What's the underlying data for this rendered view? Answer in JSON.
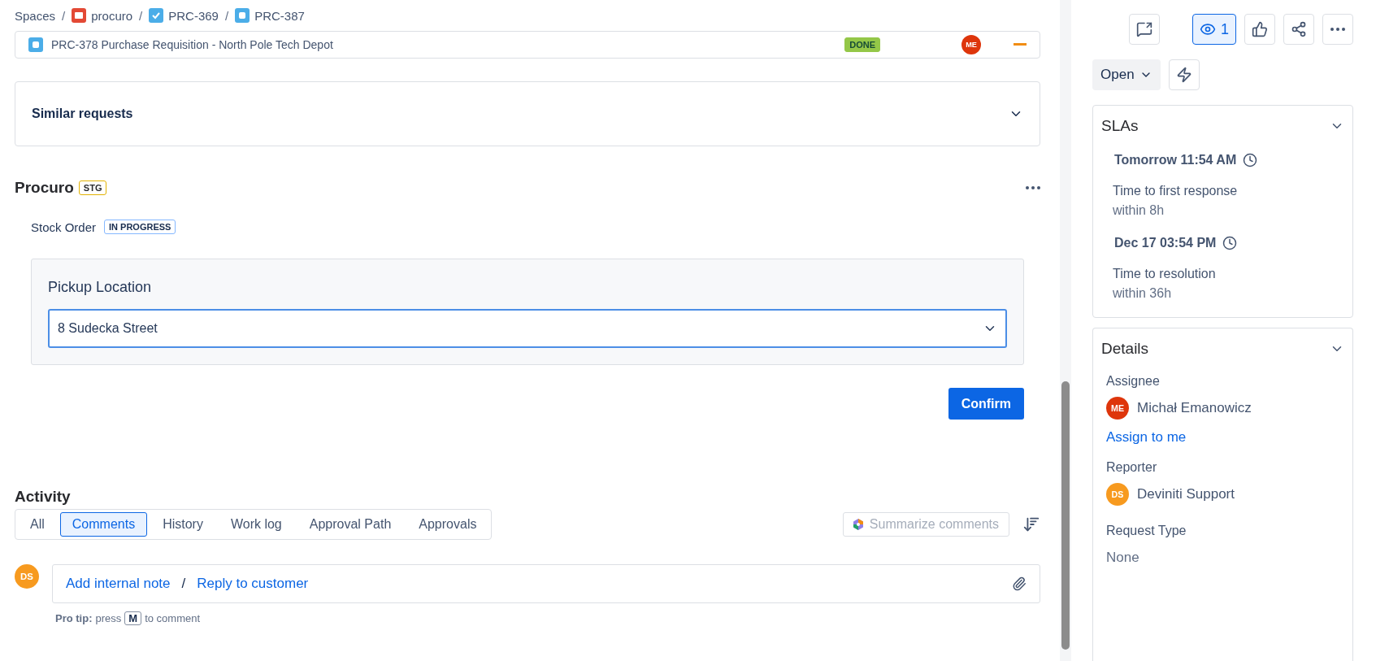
{
  "breadcrumbs": [
    {
      "label": "Spaces",
      "kind": "text",
      "sep": "/"
    },
    {
      "label": "procuro",
      "kind": "project",
      "sep": "/"
    },
    {
      "label": "PRC-369",
      "kind": "task",
      "sep": "/"
    },
    {
      "label": "PRC-387",
      "kind": "request"
    }
  ],
  "linked_item": {
    "title": "PRC-378 Purchase Requisition - North Pole Tech Depot",
    "status": "DONE",
    "assignee": "ME"
  },
  "similar_requests": {
    "title": "Similar requests"
  },
  "app_panel": {
    "title": "Procuro",
    "env": "STG",
    "item": "Stock Order",
    "status": "IN PROGRESS",
    "field_label": "Pickup Location",
    "field_value": "8 Sudecka Street",
    "confirm": "Confirm"
  },
  "activity": {
    "title": "Activity",
    "tabs": [
      {
        "label": "All",
        "selected": false
      },
      {
        "label": "Comments",
        "selected": true
      },
      {
        "label": "History",
        "selected": false
      },
      {
        "label": "Work log",
        "selected": false
      },
      {
        "label": "Approval Path",
        "selected": false
      },
      {
        "label": "Approvals",
        "selected": false
      }
    ],
    "summarize": "Summarize comments",
    "avatar": "DS",
    "add_note": "Add internal note",
    "separator": "/",
    "reply": "Reply to customer",
    "tip_label": "Pro tip:",
    "tip_press": "press",
    "tip_key": "M",
    "tip_rest": "to comment"
  },
  "toolbar": {
    "watchers": "1",
    "watching": true,
    "status": "Open"
  },
  "slas": {
    "title": "SLAs",
    "items": [
      {
        "due": "Tomorrow 11:54 AM",
        "name": "Time to first response",
        "goal": "within 8h"
      },
      {
        "due": "Dec 17 03:54 PM",
        "name": "Time to resolution",
        "goal": "within 36h"
      }
    ]
  },
  "details": {
    "title": "Details",
    "assignee_label": "Assignee",
    "assignee": {
      "initials": "ME",
      "name": "Michał Emanowicz",
      "color": "#de350b"
    },
    "assign_link": "Assign to me",
    "reporter_label": "Reporter",
    "reporter": {
      "initials": "DS",
      "name": "Deviniti Support",
      "color": "#f79a1f"
    },
    "request_type_label": "Request Type",
    "request_type": "None"
  }
}
